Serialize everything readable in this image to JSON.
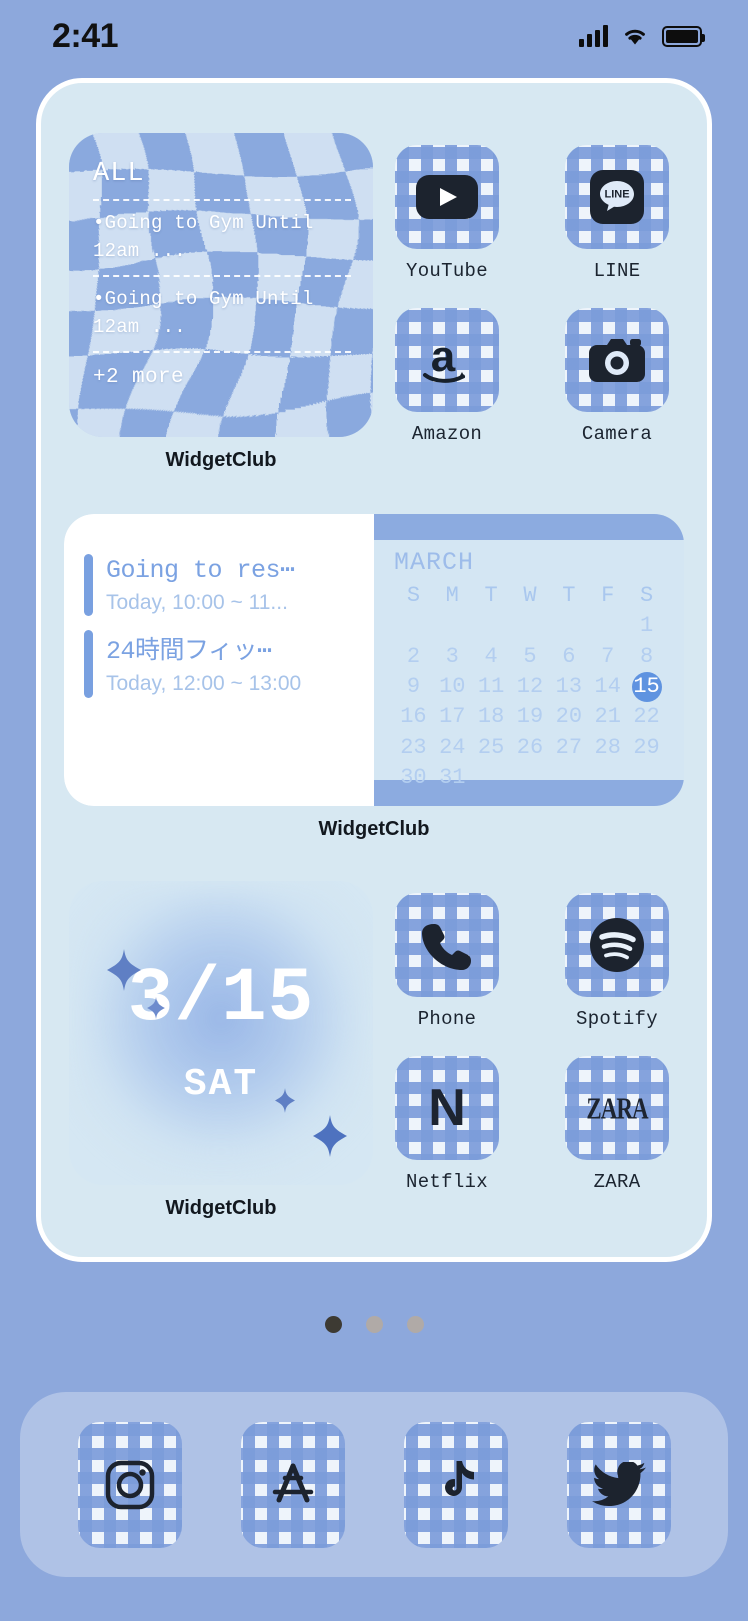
{
  "status_bar": {
    "time": "2:41",
    "icons": [
      "cellular-signal-icon",
      "wifi-icon",
      "battery-icon"
    ]
  },
  "theme": {
    "wallpaper": "#8da8dc",
    "screen_bg": "#d7e8f2",
    "gingham_blue": "#7c9cda",
    "accent_blue": "#5f93e0",
    "glyph_dark": "#1d2430",
    "dock_bg": "rgba(255,255,255,0.30)"
  },
  "widgets": {
    "todo": {
      "title": "ALL",
      "items": [
        "•Going to Gym Until 12am ...",
        "•Going to Gym Until 12am ..."
      ],
      "more": "+2 more",
      "label": "WidgetClub"
    },
    "events_calendar": {
      "label": "WidgetClub",
      "events": [
        {
          "title": "Going to res⋯",
          "time": "Today, 10:00 ~ 11..."
        },
        {
          "title": "24時間フィッ⋯",
          "time": "Today, 12:00 ~ 13:00"
        }
      ],
      "calendar": {
        "month": "MARCH",
        "weekdays": [
          "S",
          "M",
          "T",
          "W",
          "T",
          "F",
          "S"
        ],
        "lead_blanks": 6,
        "days": [
          1,
          2,
          3,
          4,
          5,
          6,
          7,
          8,
          9,
          10,
          11,
          12,
          13,
          14,
          15,
          16,
          17,
          18,
          19,
          20,
          21,
          22,
          23,
          24,
          25,
          26,
          27,
          28,
          29,
          30,
          31
        ],
        "today": 15
      }
    },
    "date": {
      "date": "3/15",
      "weekday": "SAT",
      "label": "WidgetClub"
    }
  },
  "apps": {
    "row1": [
      {
        "label": "YouTube",
        "icon": "youtube-icon"
      },
      {
        "label": "LINE",
        "icon": "line-icon"
      }
    ],
    "row2": [
      {
        "label": "Amazon",
        "icon": "amazon-icon"
      },
      {
        "label": "Camera",
        "icon": "camera-icon"
      }
    ],
    "row3": [
      {
        "label": "Phone",
        "icon": "phone-icon"
      },
      {
        "label": "Spotify",
        "icon": "spotify-icon"
      }
    ],
    "row4": [
      {
        "label": "Netflix",
        "icon": "netflix-icon"
      },
      {
        "label": "ZARA",
        "icon": "zara-icon"
      }
    ]
  },
  "dock": {
    "items": [
      {
        "label": "Instagram",
        "icon": "instagram-icon"
      },
      {
        "label": "App Store",
        "icon": "app-store-icon"
      },
      {
        "label": "TikTok",
        "icon": "tiktok-icon"
      },
      {
        "label": "Twitter",
        "icon": "twitter-icon"
      }
    ]
  },
  "page_indicator": {
    "total": 3,
    "active": 1
  },
  "glyphs": {
    "netflix": "N",
    "zara": "ZARA",
    "line": "LINE"
  }
}
